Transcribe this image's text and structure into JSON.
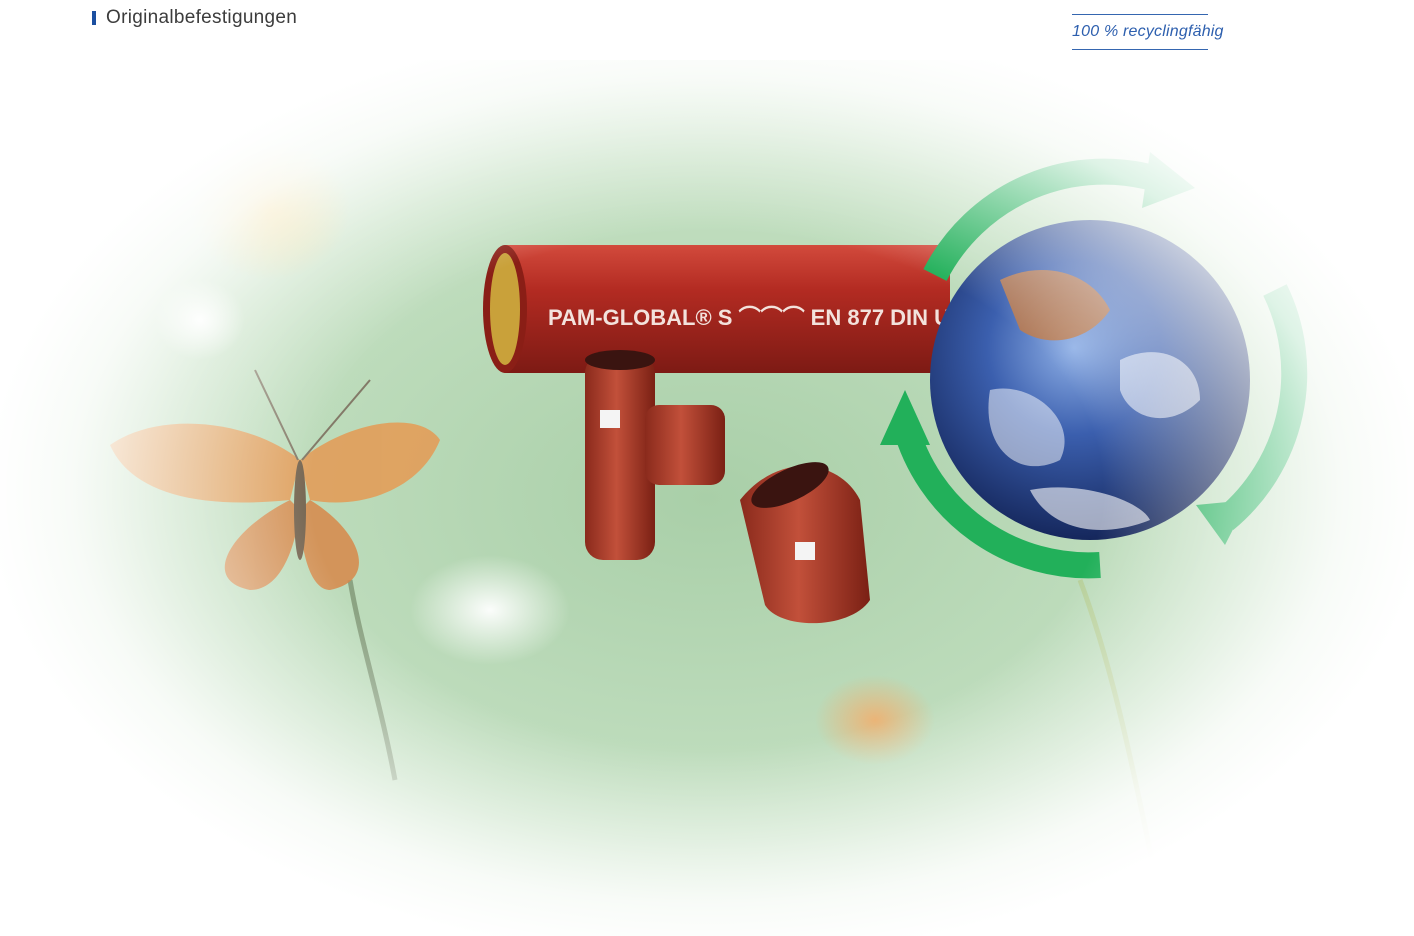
{
  "header": {
    "bullet_label": "Originalbefestigungen"
  },
  "tagline": {
    "text": "100 % recyclingfähig"
  },
  "photo": {
    "pipe_print": "PAM-GLOBAL® S ⌒⌒⌒ EN 877 DIN U",
    "colors": {
      "pipe": "#a8261f",
      "pipe_inner": "#c9a13a",
      "arrow": "#22b05a",
      "meadow": "#b9d8b6",
      "globe": "#2d4f9a"
    }
  }
}
